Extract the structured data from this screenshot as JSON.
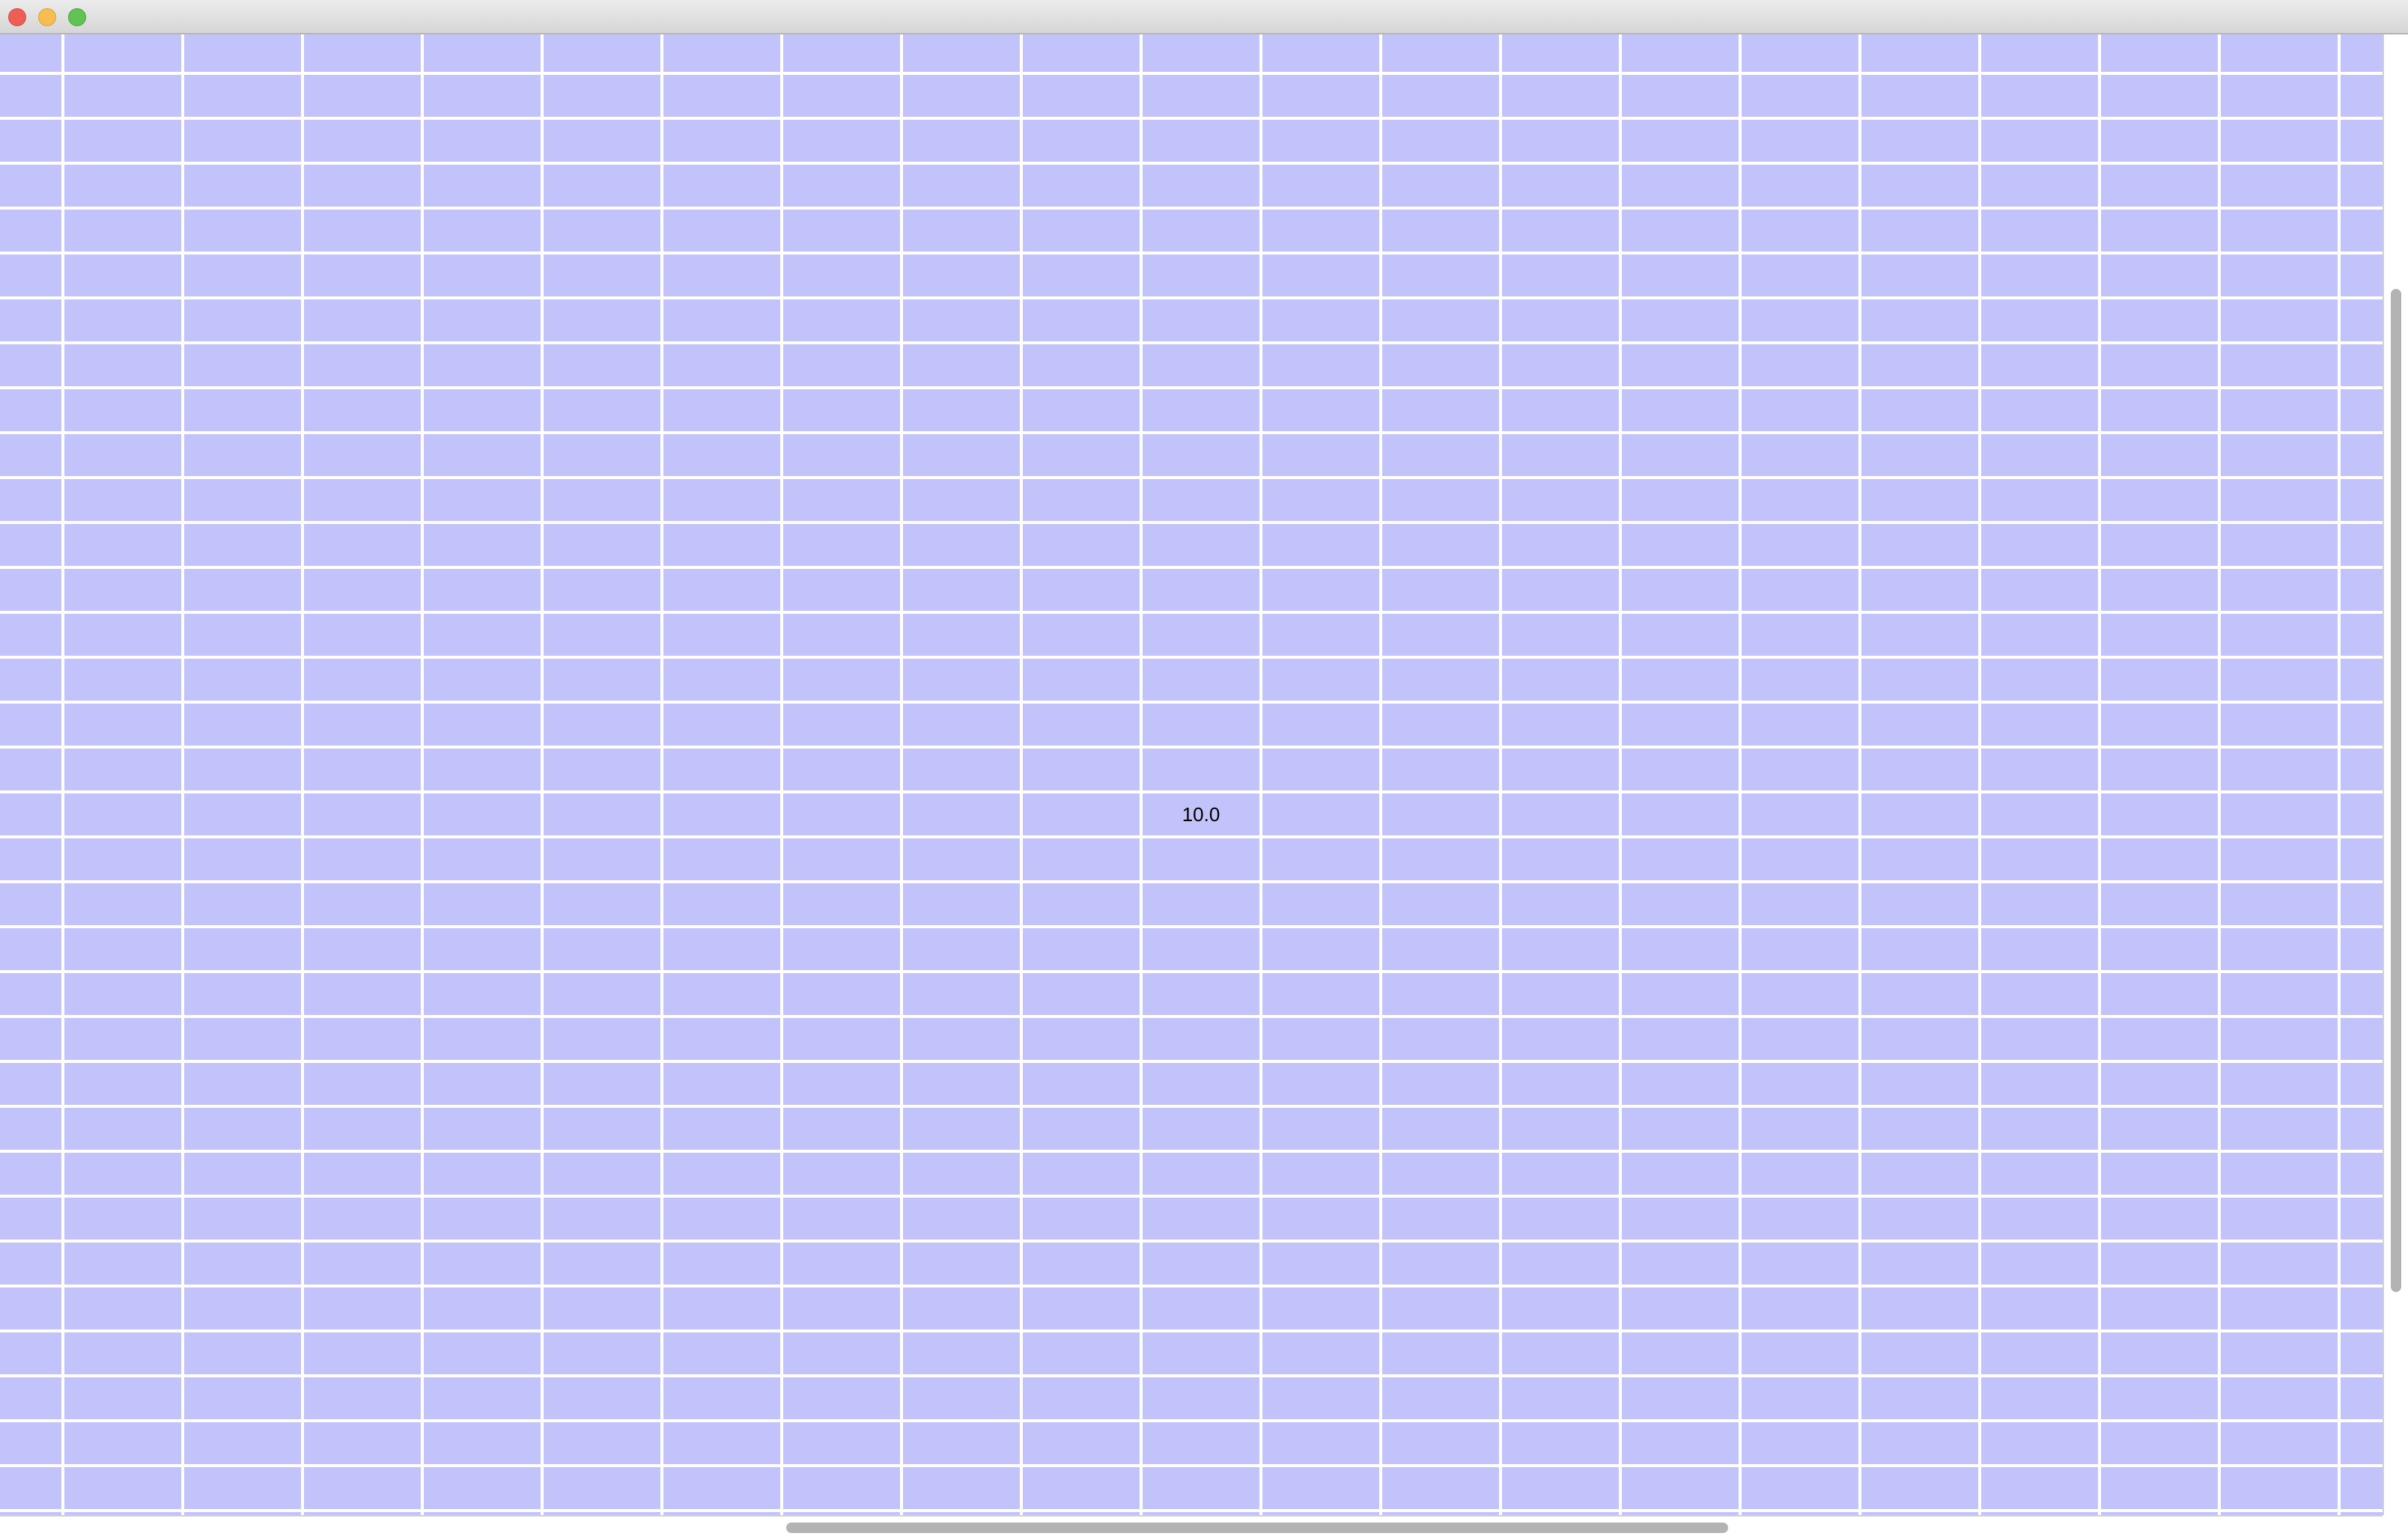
{
  "window": {
    "title": "",
    "buttons": [
      "close",
      "minimize",
      "maximize"
    ]
  },
  "grid": {
    "cell_color": "#c3c3fb",
    "line_color": "#ffffff",
    "visible_rows": 34,
    "visible_cols": 21,
    "cells": [
      {
        "row": 17,
        "col": 10,
        "value": "10.0"
      }
    ]
  },
  "scrollbars": {
    "vertical": true,
    "horizontal": true
  }
}
